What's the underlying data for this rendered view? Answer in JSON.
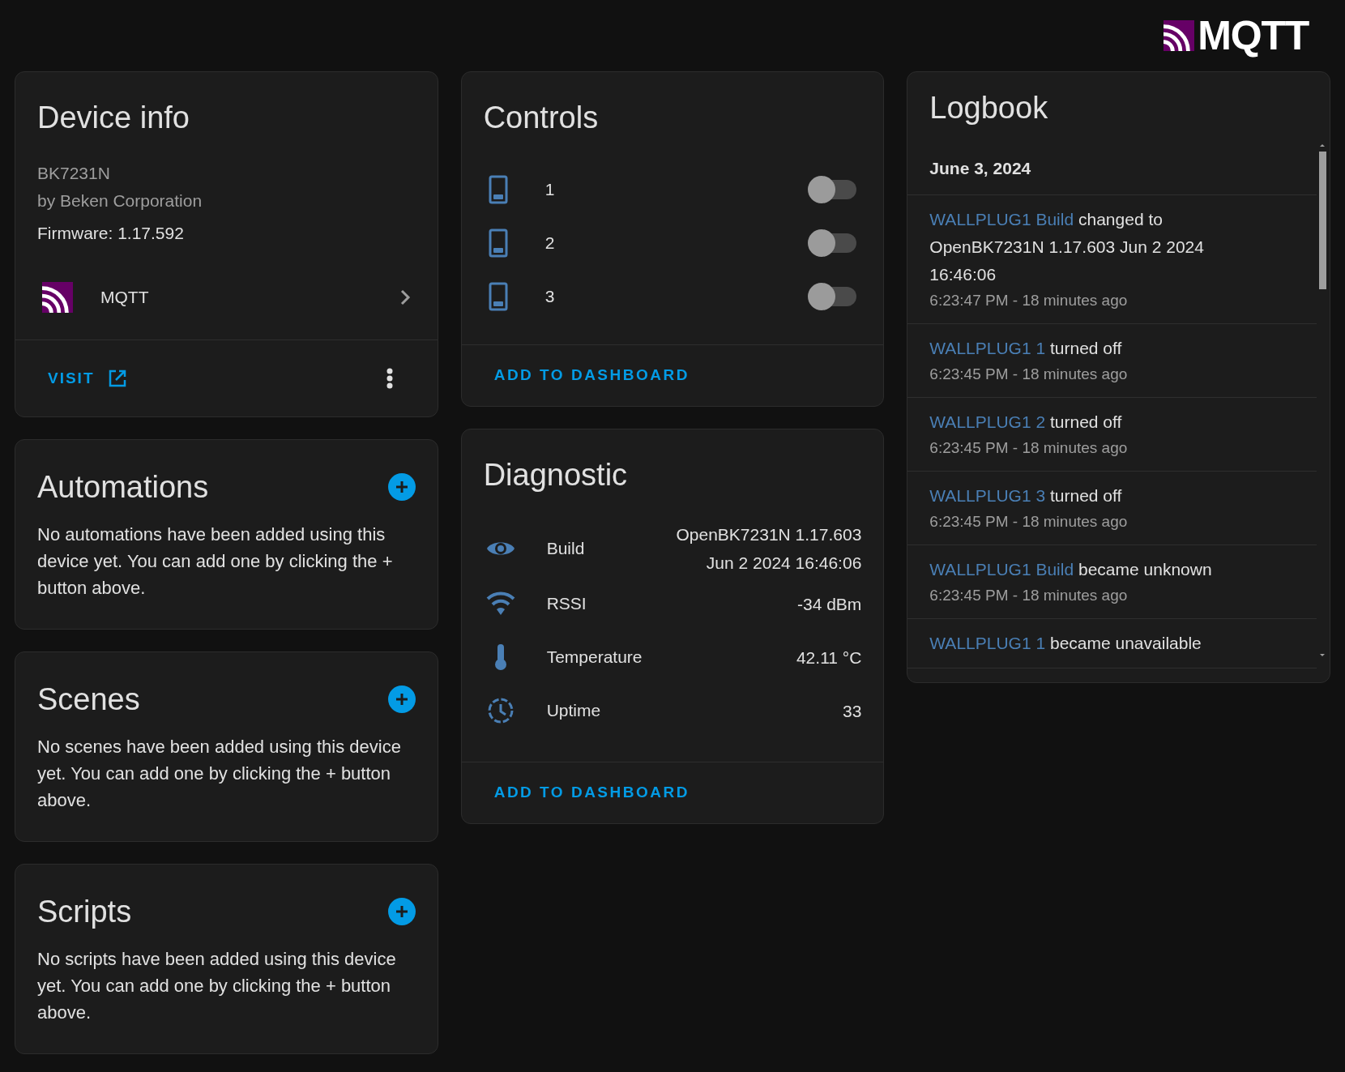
{
  "header": {
    "logo_text": "MQTT"
  },
  "device_info": {
    "title": "Device info",
    "model": "BK7231N",
    "manufacturer": "by Beken Corporation",
    "firmware": "Firmware: 1.17.592",
    "integration": "MQTT",
    "visit": "VISIT"
  },
  "automations": {
    "title": "Automations",
    "text": "No automations have been added using this device yet. You can add one by clicking the + button above."
  },
  "scenes": {
    "title": "Scenes",
    "text": "No scenes have been added using this device yet. You can add one by clicking the + button above."
  },
  "scripts": {
    "title": "Scripts",
    "text": "No scripts have been added using this device yet. You can add one by clicking the + button above."
  },
  "controls": {
    "title": "Controls",
    "items": [
      {
        "name": "1",
        "on": false
      },
      {
        "name": "2",
        "on": false
      },
      {
        "name": "3",
        "on": false
      }
    ],
    "action": "ADD TO DASHBOARD"
  },
  "diagnostic": {
    "title": "Diagnostic",
    "items": [
      {
        "kind": "build",
        "name": "Build",
        "value": "OpenBK7231N 1.17.603 Jun 2 2024 16:46:06"
      },
      {
        "kind": "signal",
        "name": "RSSI",
        "value": "-34 dBm"
      },
      {
        "kind": "temperature",
        "name": "Temperature",
        "value": "42.11 °C"
      },
      {
        "kind": "uptime",
        "name": "Uptime",
        "value": "33"
      }
    ],
    "action": "ADD TO DASHBOARD"
  },
  "logbook": {
    "title": "Logbook",
    "date": "June 3, 2024",
    "entries": [
      {
        "entity": "WALLPLUG1 Build",
        "message": "changed to OpenBK7231N 1.17.603 Jun 2 2024 16:46:06",
        "time": "6:23:47 PM - 18 minutes ago"
      },
      {
        "entity": "WALLPLUG1 1",
        "message": "turned off",
        "time": "6:23:45 PM - 18 minutes ago"
      },
      {
        "entity": "WALLPLUG1 2",
        "message": "turned off",
        "time": "6:23:45 PM - 18 minutes ago"
      },
      {
        "entity": "WALLPLUG1 3",
        "message": "turned off",
        "time": "6:23:45 PM - 18 minutes ago"
      },
      {
        "entity": "WALLPLUG1 Build",
        "message": "became unknown",
        "time": "6:23:45 PM - 18 minutes ago"
      },
      {
        "entity": "WALLPLUG1 1",
        "message": "became unavailable"
      }
    ]
  }
}
